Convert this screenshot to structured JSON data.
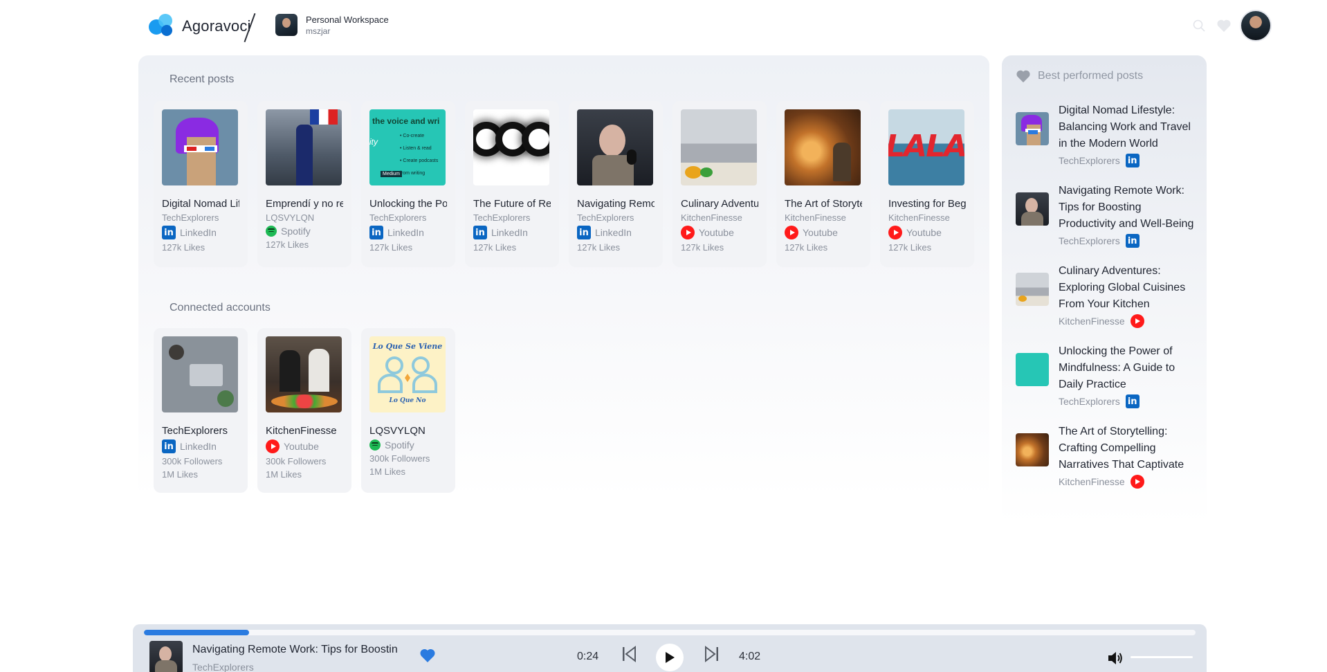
{
  "app": {
    "name": "Agoravoci",
    "workspace_title": "Personal Workspace",
    "workspace_user": "mszjar"
  },
  "colors": {
    "accent": "#2a7be0",
    "linkedin": "#0a66c2",
    "youtube": "#ff1a1a",
    "spotify": "#1db954"
  },
  "recent": {
    "title": "Recent posts",
    "posts": [
      {
        "title": "Digital Nomad Lifestyle: Balancing Work and Travel in the Modern World",
        "author": "TechExplorers",
        "platform": "LinkedIn",
        "platform_icon": "linkedin-icon",
        "likes": "127k Likes"
      },
      {
        "title": "Emprendí y no recuerdo",
        "author": "LQSVYLQN",
        "platform": "Spotify",
        "platform_icon": "spotify-icon",
        "likes": "127k Likes"
      },
      {
        "title": "Unlocking the Power of Mindfulness",
        "author": "TechExplorers",
        "platform": "LinkedIn",
        "platform_icon": "linkedin-icon",
        "likes": "127k Likes"
      },
      {
        "title": "The Future of Remote",
        "author": "TechExplorers",
        "platform": "LinkedIn",
        "platform_icon": "linkedin-icon",
        "likes": "127k Likes"
      },
      {
        "title": "Navigating Remote Work",
        "author": "TechExplorers",
        "platform": "LinkedIn",
        "platform_icon": "linkedin-icon",
        "likes": "127k Likes"
      },
      {
        "title": "Culinary Adventures",
        "author": "KitchenFinesse",
        "platform": "Youtube",
        "platform_icon": "youtube-icon",
        "likes": "127k Likes"
      },
      {
        "title": "The Art of Storytelling",
        "author": "KitchenFinesse",
        "platform": "Youtube",
        "platform_icon": "youtube-icon",
        "likes": "127k Likes"
      },
      {
        "title": "Investing for Beginners",
        "author": "KitchenFinesse",
        "platform": "Youtube",
        "platform_icon": "youtube-icon",
        "likes": "127k Likes"
      }
    ]
  },
  "accounts": {
    "title": "Connected accounts",
    "items": [
      {
        "name": "TechExplorers",
        "platform": "LinkedIn",
        "followers": "300k Followers",
        "likes": "1M Likes"
      },
      {
        "name": "KitchenFinesse",
        "platform": "Youtube",
        "followers": "300k Followers",
        "likes": "1M Likes"
      },
      {
        "name": "LQSVYLQN",
        "platform": "Spotify",
        "followers": "300k Followers",
        "likes": "1M Likes"
      }
    ],
    "lqs_text_top": "Lo Que Se Viene",
    "lqs_text_bottom": "Lo Que No"
  },
  "thumb_texts": {
    "teal_top": "the voice and wri",
    "teal_lines": [
      "Co-create",
      "Listen & read",
      "Create podcasts from writing"
    ],
    "teal_left": "ity",
    "teal_brand": "Medium",
    "sea_text": "LALA"
  },
  "best": {
    "title": "Best performed posts",
    "posts": [
      {
        "title": "Digital Nomad Lifestyle: Balancing Work and Travel in the Modern World",
        "author": "TechExplorers",
        "platform": "LinkedIn"
      },
      {
        "title": "Navigating Remote Work: Tips for Boosting Productivity and Well-Being",
        "author": "TechExplorers",
        "platform": "LinkedIn"
      },
      {
        "title": "Culinary Adventures: Exploring Global Cuisines From Your Kitchen",
        "author": "KitchenFinesse",
        "platform": "Youtube"
      },
      {
        "title": "Unlocking the Power of Mindfulness: A Guide to Daily Practice",
        "author": "TechExplorers",
        "platform": "LinkedIn"
      },
      {
        "title": "The Art of Storytelling: Crafting Compelling Narratives That Captivate",
        "author": "KitchenFinesse",
        "platform": "Youtube"
      }
    ]
  },
  "player": {
    "title": "Navigating Remote Work: Tips for Boostin",
    "author": "TechExplorers",
    "current_time": "0:24",
    "total_time": "4:02",
    "progress_percent": 10
  }
}
